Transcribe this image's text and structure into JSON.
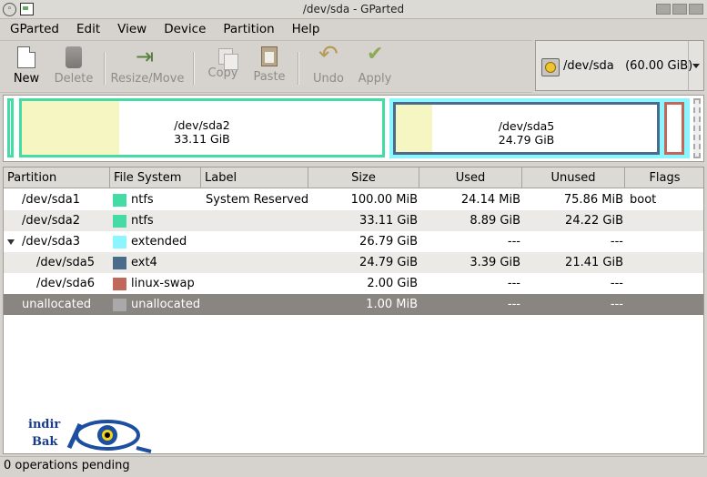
{
  "window": {
    "title": "/dev/sda - GParted"
  },
  "menubar": [
    "GParted",
    "Edit",
    "View",
    "Device",
    "Partition",
    "Help"
  ],
  "toolbar": {
    "new": "New",
    "delete": "Delete",
    "resize_move": "Resize/Move",
    "copy": "Copy",
    "paste": "Paste",
    "undo": "Undo",
    "apply": "Apply"
  },
  "device_selector": {
    "device": "/dev/sda",
    "size": "(60.00 GiB)"
  },
  "disk_map": {
    "sda2": {
      "name": "/dev/sda2",
      "size": "33.11 GiB",
      "used_fraction": 0.27
    },
    "sda5": {
      "name": "/dev/sda5",
      "size": "24.79 GiB",
      "used_fraction": 0.14
    }
  },
  "colors": {
    "ntfs": "#44dca4",
    "extended": "#8bf6ff",
    "ext4": "#4b6b8a",
    "linux_swap": "#c0685c",
    "unallocated": "#a9a9a9",
    "selection": "#898581"
  },
  "table": {
    "headers": [
      "Partition",
      "File System",
      "Label",
      "Size",
      "Used",
      "Unused",
      "Flags"
    ],
    "rows": [
      {
        "partition": "/dev/sda1",
        "fs": "ntfs",
        "label": "System Reserved",
        "size": "100.00 MiB",
        "used": "24.14 MiB",
        "unused": "75.86 MiB",
        "flags": "boot"
      },
      {
        "partition": "/dev/sda2",
        "fs": "ntfs",
        "label": "",
        "size": "33.11 GiB",
        "used": "8.89 GiB",
        "unused": "24.22 GiB",
        "flags": ""
      },
      {
        "partition": "/dev/sda3",
        "fs": "extended",
        "label": "",
        "size": "26.79 GiB",
        "used": "---",
        "unused": "---",
        "flags": ""
      },
      {
        "partition": "/dev/sda5",
        "fs": "ext4",
        "label": "",
        "size": "24.79 GiB",
        "used": "3.39 GiB",
        "unused": "21.41 GiB",
        "flags": ""
      },
      {
        "partition": "/dev/sda6",
        "fs": "linux-swap",
        "label": "",
        "size": "2.00 GiB",
        "used": "---",
        "unused": "---",
        "flags": ""
      },
      {
        "partition": "unallocated",
        "fs": "unallocated",
        "label": "",
        "size": "1.00 MiB",
        "used": "---",
        "unused": "---",
        "flags": ""
      }
    ]
  },
  "watermark": {
    "line1": "indir",
    "line2": "Bak"
  },
  "status": "0 operations pending"
}
